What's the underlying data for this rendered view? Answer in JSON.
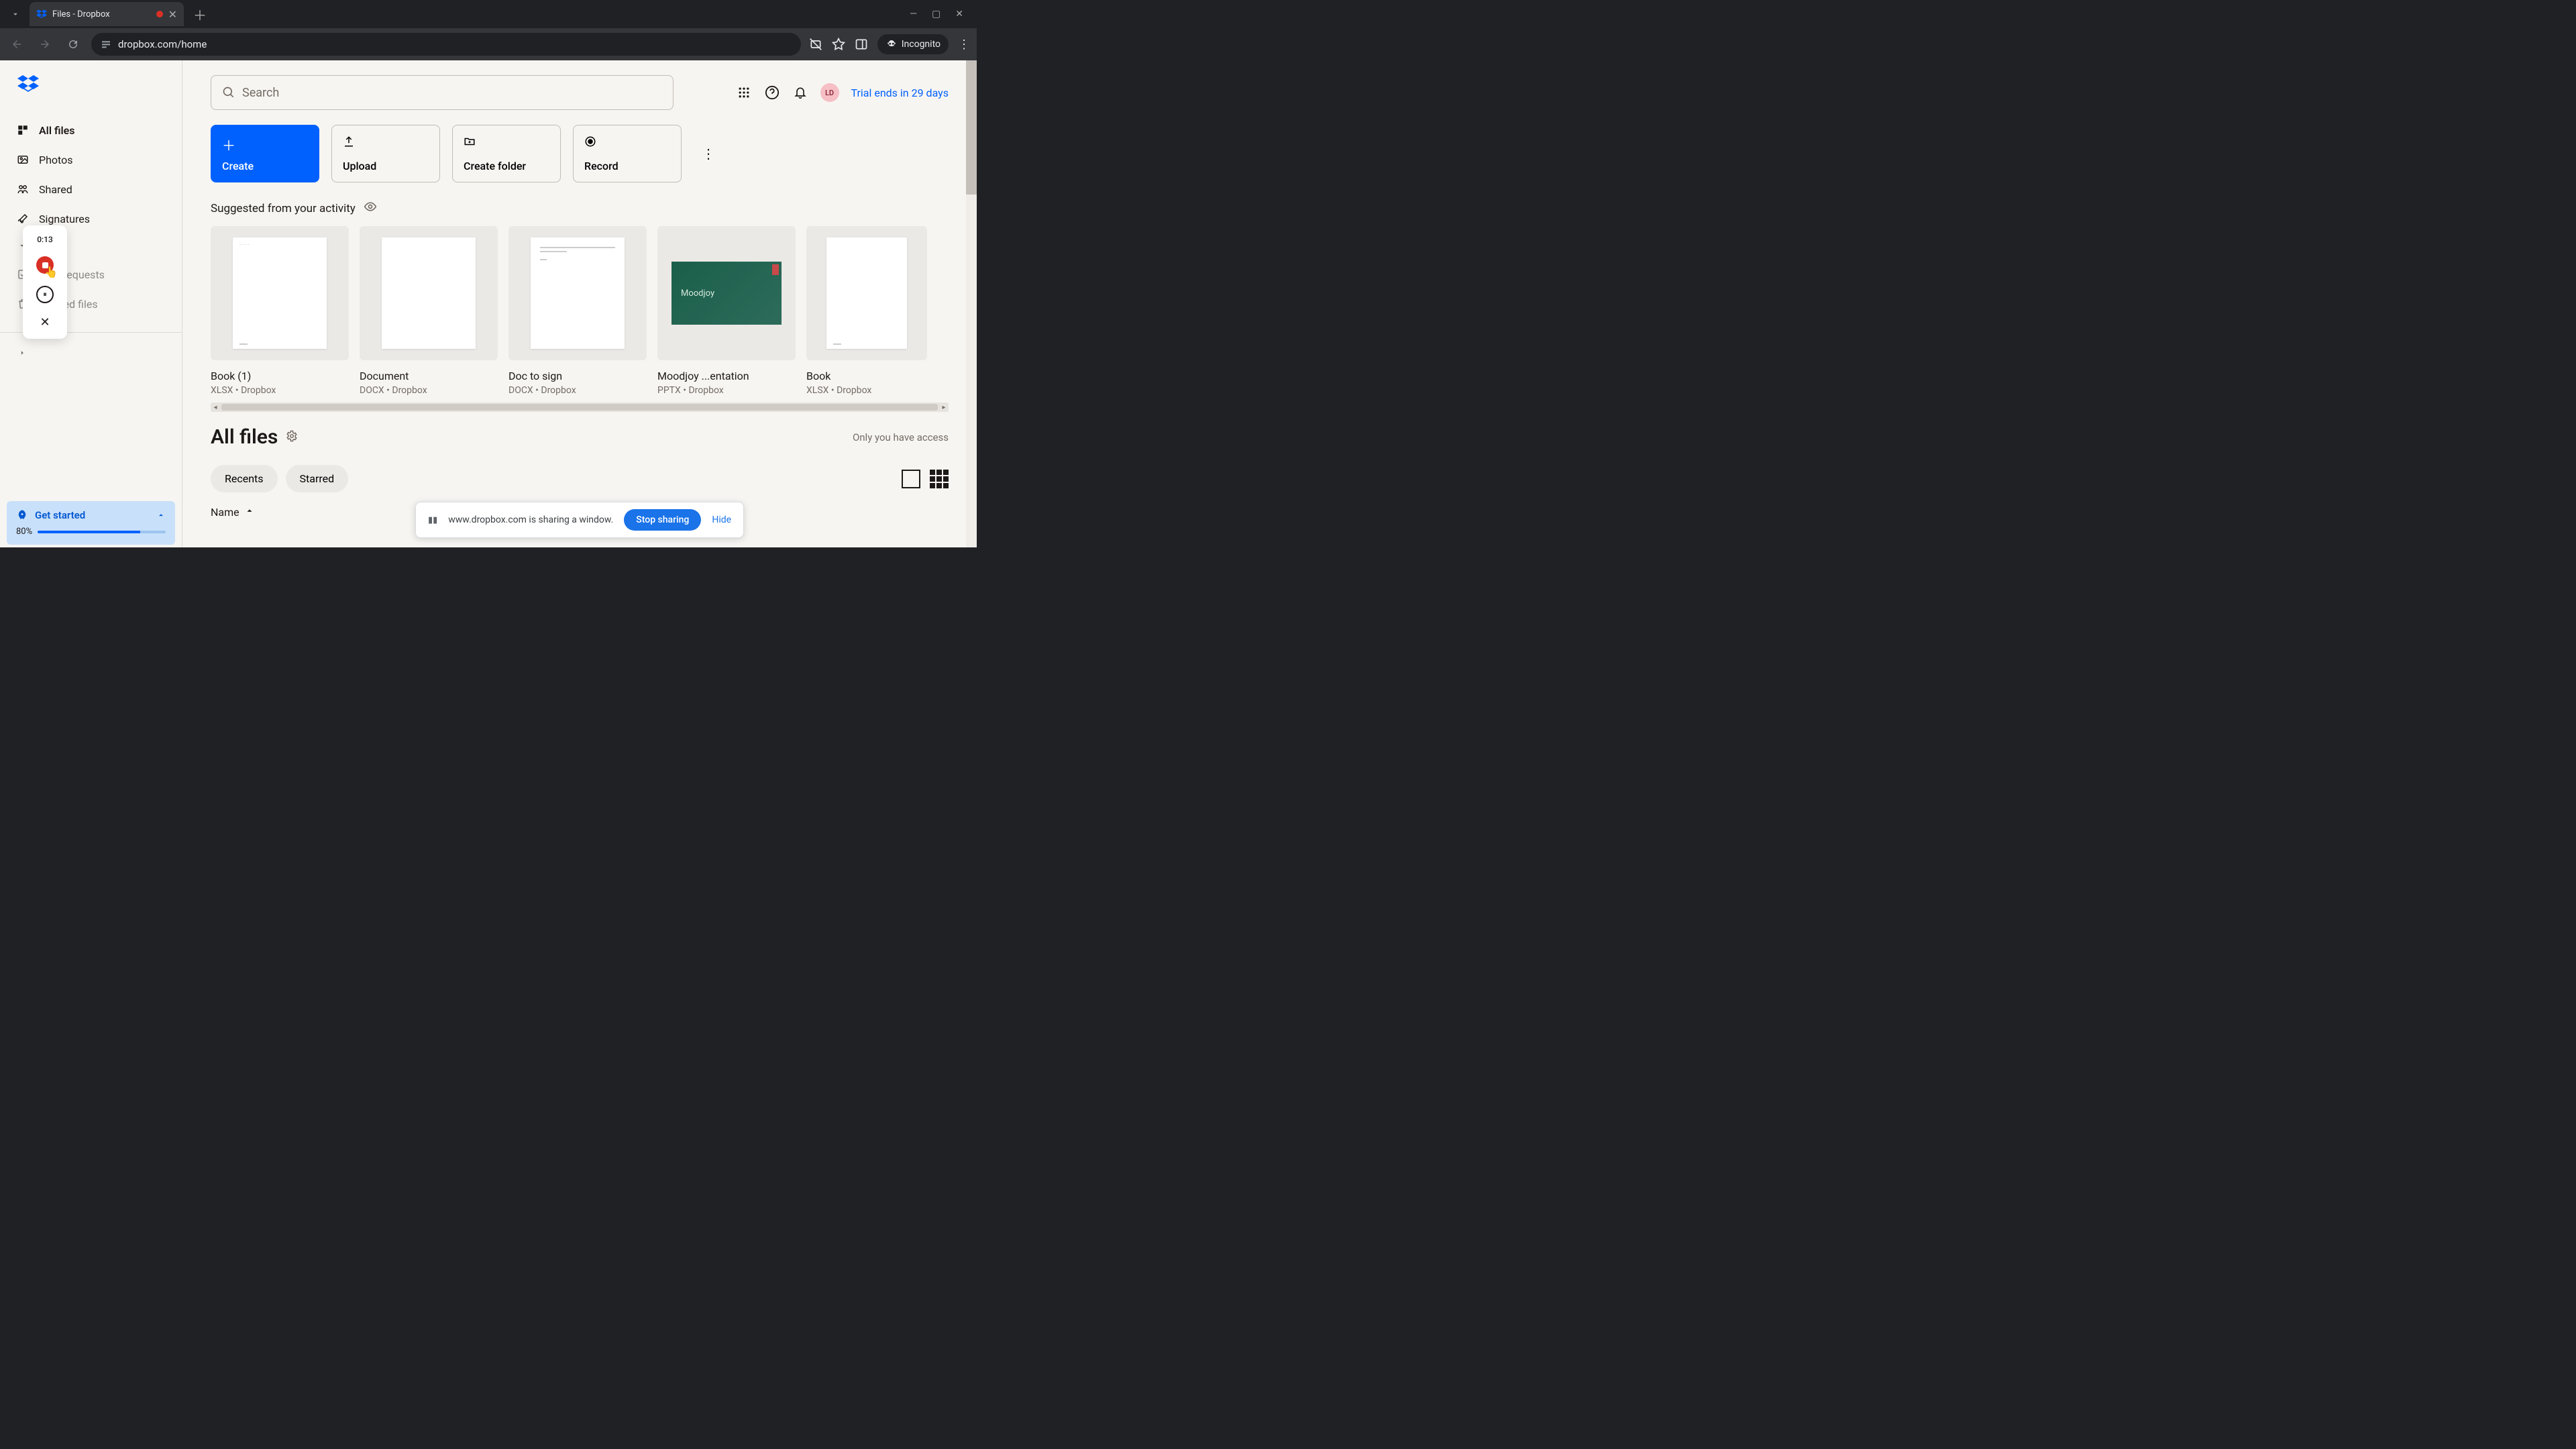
{
  "browser": {
    "tab_title": "Files - Dropbox",
    "url": "dropbox.com/home",
    "incognito_label": "Incognito"
  },
  "sidebar": {
    "items": [
      {
        "label": "All files"
      },
      {
        "label": "Photos"
      },
      {
        "label": "Shared"
      },
      {
        "label": "Signatures"
      }
    ],
    "sent_label": "Sent requests",
    "deleted_label": "Deleted files"
  },
  "recording": {
    "time": "0:13"
  },
  "get_started": {
    "label": "Get started",
    "percent": "80%",
    "percent_value": 80
  },
  "header": {
    "search_placeholder": "Search",
    "avatar_initials": "LD",
    "trial_text": "Trial ends in 29 days"
  },
  "actions": {
    "create": "Create",
    "upload": "Upload",
    "create_folder": "Create folder",
    "record": "Record"
  },
  "suggested": {
    "title": "Suggested from your activity",
    "cards": [
      {
        "title": "Book (1)",
        "meta": "XLSX • Dropbox"
      },
      {
        "title": "Document",
        "meta": "DOCX • Dropbox"
      },
      {
        "title": "Doc to sign",
        "meta": "DOCX • Dropbox"
      },
      {
        "title": "Moodjoy ...entation",
        "meta": "PPTX • Dropbox"
      },
      {
        "title": "Book",
        "meta": "XLSX • Dropbox"
      }
    ],
    "moodjoy_label": "Moodjoy"
  },
  "files": {
    "heading": "All files",
    "access_text": "Only you have access",
    "tabs": {
      "recents": "Recents",
      "starred": "Starred"
    },
    "col_name": "Name"
  },
  "share_bar": {
    "message": "www.dropbox.com is sharing a window.",
    "stop": "Stop sharing",
    "hide": "Hide"
  }
}
